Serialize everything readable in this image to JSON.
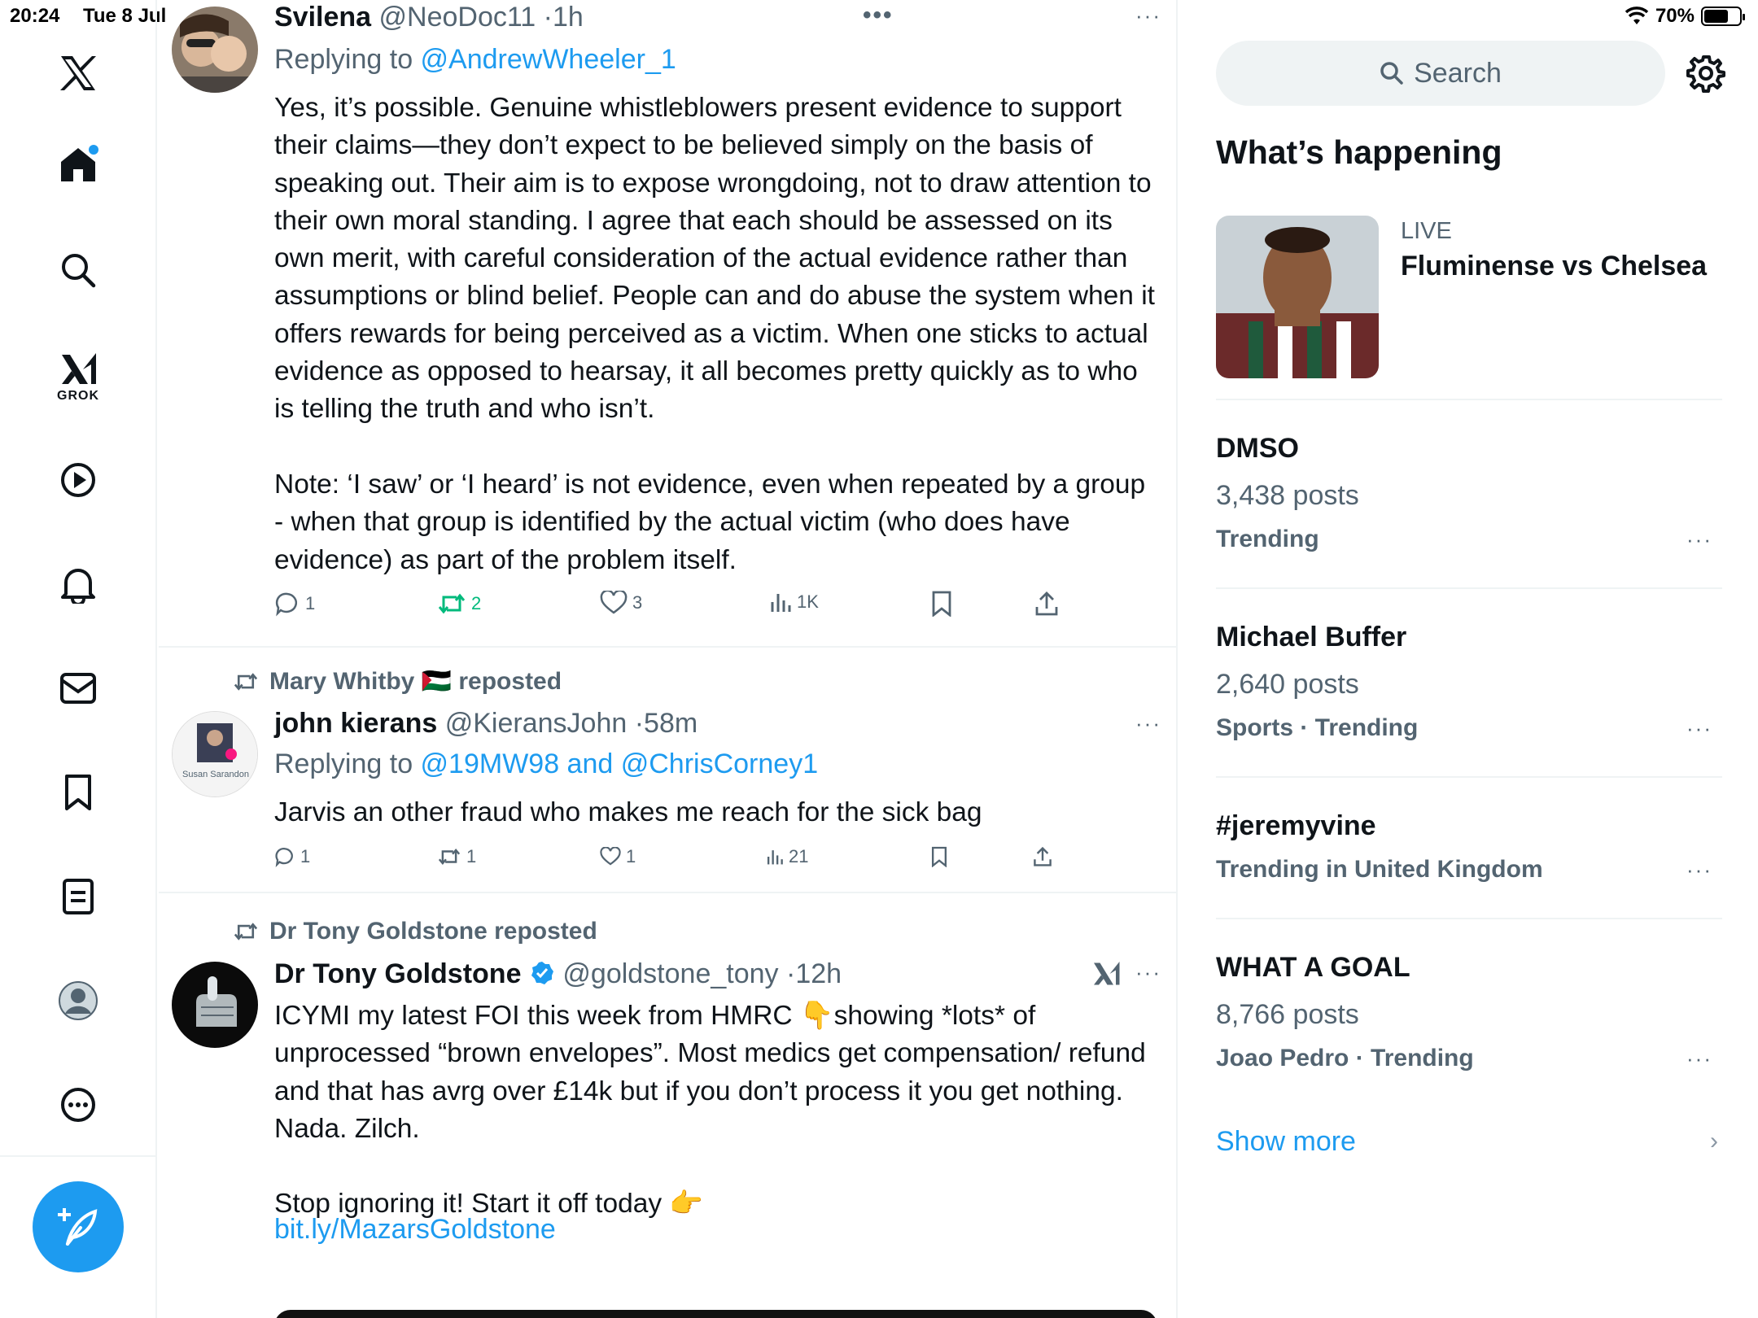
{
  "status_bar": {
    "time": "20:24",
    "date": "Tue 8 Jul",
    "battery": "70%",
    "battery_level": 0.7
  },
  "left_nav": {
    "items": [
      {
        "name": "x-logo-icon"
      },
      {
        "name": "home-icon",
        "has_notification_dot": true
      },
      {
        "name": "explore-icon"
      },
      {
        "name": "grok-icon",
        "label": "GROK"
      },
      {
        "name": "video-icon"
      },
      {
        "name": "notifications-icon"
      },
      {
        "name": "messages-icon"
      },
      {
        "name": "bookmarks-icon"
      },
      {
        "name": "lists-icon"
      },
      {
        "name": "profile-icon"
      },
      {
        "name": "more-icon"
      }
    ],
    "compose_icon": "compose-icon",
    "accent_color": "#1d9bf0"
  },
  "feed": {
    "tweets": [
      {
        "name": "Svilena",
        "handle": "@NeoDoc11",
        "time": "1h",
        "replying_to_prefix": "Replying to ",
        "replying_to": "@AndrewWheeler_1",
        "text": "Yes, it’s possible. Genuine whistleblowers present evidence to support their claims—they don’t expect to be believed simply on the basis of speaking out. Their aim is to expose wrongdoing, not to draw attention to their own moral standing. I agree that each should be assessed on its own merit, with careful consideration of the actual evidence rather than assumptions or blind belief. People can and do abuse the system when it offers rewards for being perceived as a victim. When one sticks to actual evidence as opposed to hearsay, it all becomes pretty quickly as to who is telling the truth and who isn’t.\n\nNote: ‘I saw’ or ‘I heard’ is not evidence, even when repeated by a group - when that group is identified by the actual victim (who does have evidence) as part of the problem itself.",
        "replies": "1",
        "reposts": "2",
        "likes": "3",
        "views": "1K",
        "reposted_by_me": true
      },
      {
        "repost_label": "Mary Whitby 🇵🇸 reposted",
        "name": "john kierans",
        "handle": "@KieransJohn",
        "time": "58m",
        "avatar_caption": "Susan Sarandon",
        "replying_to_prefix": "Replying to ",
        "replying_to": "@19MW98 and @ChrisCorney1",
        "text": "Jarvis an other fraud who makes me reach for the sick bag",
        "replies": "1",
        "reposts": "1",
        "likes": "1",
        "views": "21"
      },
      {
        "repost_label": "Dr Tony Goldstone reposted",
        "name": "Dr Tony Goldstone",
        "verified": true,
        "handle": "@goldstone_tony",
        "time": "12h",
        "text": "ICYMI my latest FOI this week from HMRC 👇showing *lots* of unprocessed “brown envelopes”. Most medics get compensation/ refund and that has avrg over £14k but if you don’t process it you get nothing. Nada. Zilch.\n\nStop ignoring it! Start it off today 👉",
        "link": "bit.ly/MazarsGoldstone"
      }
    ]
  },
  "right": {
    "search_placeholder": "Search",
    "section_title": "What’s happening",
    "live": {
      "label": "LIVE",
      "title": "Fluminense vs Chelsea"
    },
    "trends": [
      {
        "title": "DMSO",
        "count": "3,438 posts",
        "context": "Trending"
      },
      {
        "title": "Michael Buffer",
        "count": "2,640 posts",
        "context": "Sports · Trending"
      },
      {
        "title": "#jeremyvine",
        "count": "",
        "context": "Trending in United Kingdom"
      },
      {
        "title": "WHAT A GOAL",
        "count": "8,766 posts",
        "context": "Joao Pedro · Trending"
      }
    ],
    "show_more": "Show more"
  }
}
